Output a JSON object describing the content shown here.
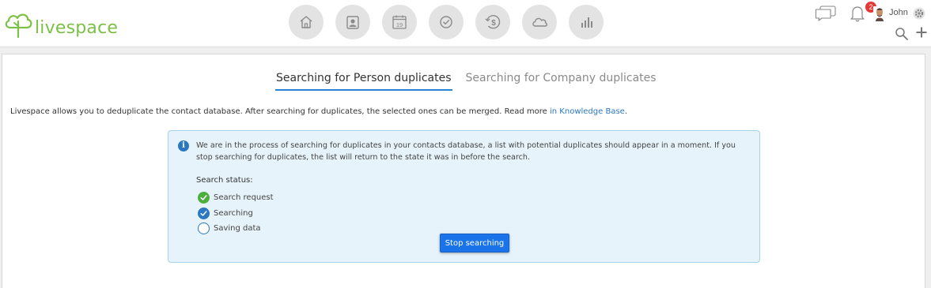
{
  "header": {
    "logo_text": "livespace",
    "nav": [
      {
        "icon": "home-icon"
      },
      {
        "icon": "contacts-icon"
      },
      {
        "icon": "calendar-icon",
        "day": "19"
      },
      {
        "icon": "tasks-icon"
      },
      {
        "icon": "deals-icon"
      },
      {
        "icon": "cloud-icon"
      },
      {
        "icon": "reports-icon"
      }
    ],
    "notifications_count": "2",
    "user_name": "John"
  },
  "tabs": {
    "person": "Searching for Person duplicates",
    "company": "Searching for Company duplicates"
  },
  "intro": {
    "text": "Livespace allows you to deduplicate the contact database. After searching for duplicates, the selected ones can be merged. Read more ",
    "link": "in Knowledge Base",
    "suffix": "."
  },
  "info": {
    "icon": "i",
    "message": "We are in the process of searching for duplicates in your contacts database, a list with potential duplicates should appear in a moment. If you stop searching for duplicates, the list will return to the state it was in before the search.",
    "status_title": "Search status:",
    "statuses": [
      {
        "label": "Search request",
        "state": "done"
      },
      {
        "label": "Searching",
        "state": "in-progress"
      },
      {
        "label": "Saving data",
        "state": "pending"
      }
    ],
    "stop_button": "Stop searching"
  },
  "colors": {
    "brand_green": "#7cc045",
    "accent_blue": "#2a84d6",
    "button_blue": "#1a73e8",
    "info_bg": "#e7f3fa",
    "badge_red": "#e53935"
  }
}
